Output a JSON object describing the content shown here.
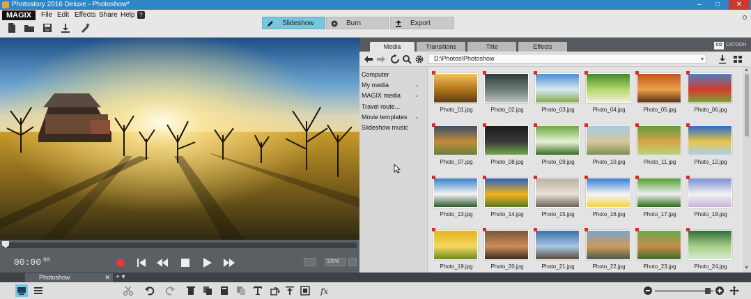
{
  "window": {
    "title": "Photostory 2016 Deluxe - Photoshow*",
    "minimize": "–",
    "maximize": "□",
    "close": "✕"
  },
  "app": {
    "logo": "MAGIX"
  },
  "menu": [
    "File",
    "Edit",
    "Effects",
    "Share",
    "Help"
  ],
  "toolbar": {
    "icons": [
      "new-file-icon",
      "open-folder-icon",
      "save-icon",
      "download-icon",
      "magic-wand-icon"
    ]
  },
  "modes": [
    {
      "label": "Slideshow",
      "icon": "pencil-icon",
      "active": true
    },
    {
      "label": "Burn",
      "icon": "disc-icon",
      "active": false
    },
    {
      "label": "Export",
      "icon": "upload-icon",
      "active": false
    }
  ],
  "transport": {
    "timecode": "00:00",
    "frames": "00",
    "zoom": "100%"
  },
  "browser": {
    "tabs": [
      "Media",
      "Transitions",
      "Title",
      "Effects"
    ],
    "active_tab": "Media",
    "catooh_badge": "CO",
    "catooh_label": "CATOOH",
    "path": "D:\\Photos\\Photoshow",
    "folders": [
      {
        "label": "Computer",
        "expandable": false
      },
      {
        "label": "My media",
        "expandable": true
      },
      {
        "label": "MAGIX media",
        "expandable": true
      },
      {
        "label": "Travel route...",
        "expandable": false
      },
      {
        "label": "Movie templates",
        "expandable": true
      },
      {
        "label": "Slideshow music",
        "expandable": false
      }
    ],
    "photos": [
      "Photo_01.jpg",
      "Photo_02.jpg",
      "Photo_03.jpg",
      "Photo_04.jpg",
      "Photo_05.jpg",
      "Photo_06.jpg",
      "Photo_07.jpg",
      "Photo_08.jpg",
      "Photo_09.jpg",
      "Photo_10.jpg",
      "Photo_11.jpg",
      "Photo_12.jpg",
      "Photo_13.jpg",
      "Photo_14.jpg",
      "Photo_15.jpg",
      "Photo_16.jpg",
      "Photo_17.jpg",
      "Photo_18.jpg",
      "Photo_19.jpg",
      "Photo_20.jpg",
      "Photo_21.jpg",
      "Photo_22.jpg",
      "Photo_23.jpg",
      "Photo_24.jpg"
    ]
  },
  "project": {
    "tab": "Photoshow",
    "close": "✕",
    "add": "+ ▾"
  },
  "colors": {
    "accent": "#78c6dd",
    "titlebar": "#2e86c7",
    "marker": "#d92b2b"
  }
}
